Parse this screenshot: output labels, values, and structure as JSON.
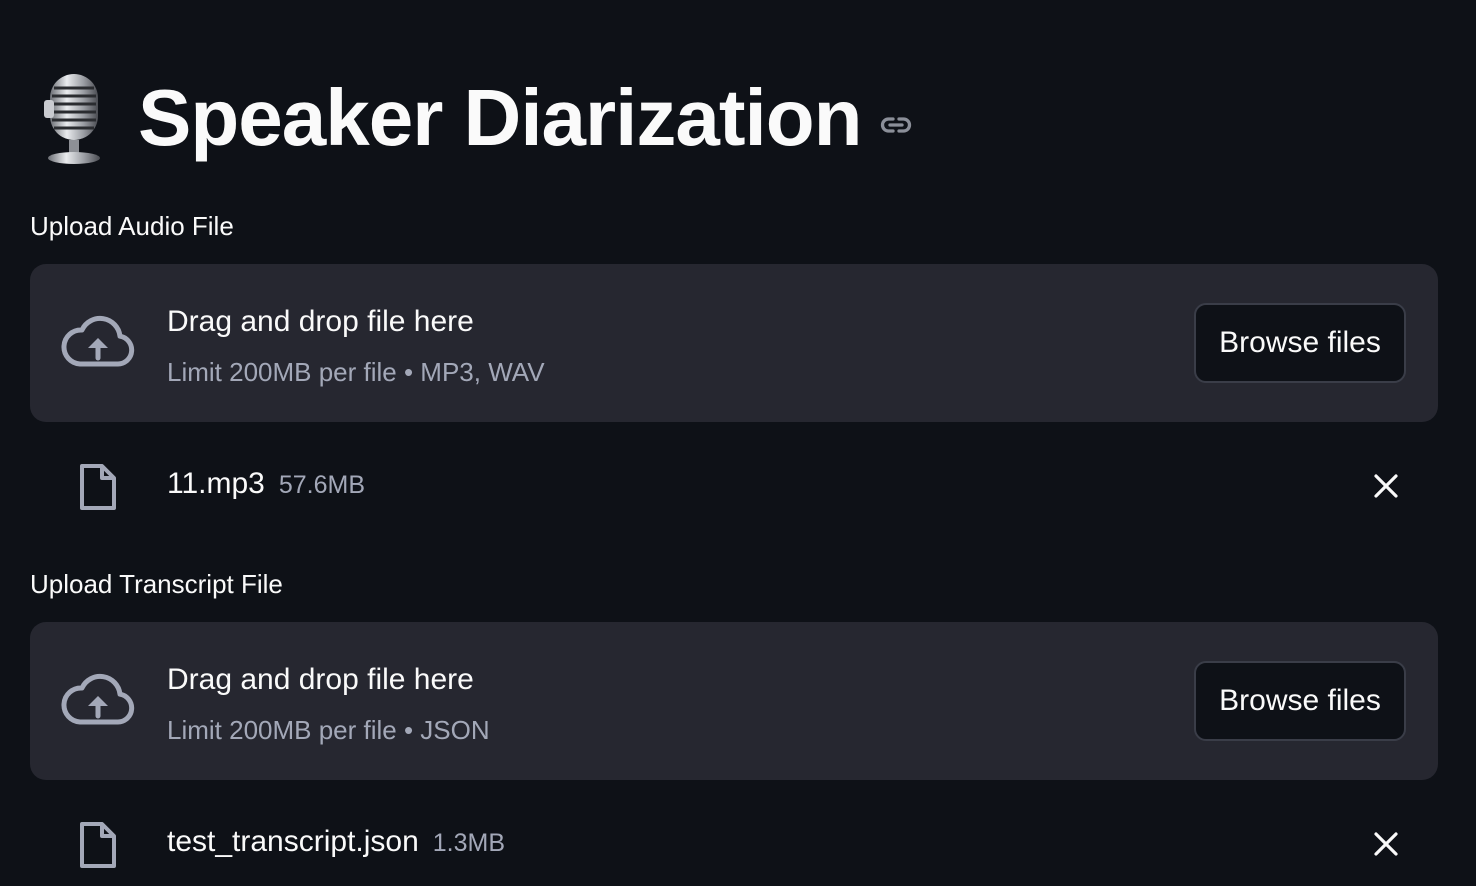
{
  "page": {
    "title": "Speaker Diarization",
    "title_icon": "studio-microphone-icon",
    "anchor_icon": "link-icon"
  },
  "uploaders": [
    {
      "label": "Upload Audio File",
      "drop_title": "Drag and drop file here",
      "drop_limit": "Limit 200MB per file • MP3, WAV",
      "browse_label": "Browse files",
      "file": {
        "name": "11.mp3",
        "size": "57.6MB"
      }
    },
    {
      "label": "Upload Transcript File",
      "drop_title": "Drag and drop file here",
      "drop_limit": "Limit 200MB per file • JSON",
      "browse_label": "Browse files",
      "file": {
        "name": "test_transcript.json",
        "size": "1.3MB"
      }
    }
  ],
  "colors": {
    "background": "#0e1117",
    "dropzone": "#262730",
    "text": "#fafafa",
    "muted_text": "#a3a8b8"
  }
}
